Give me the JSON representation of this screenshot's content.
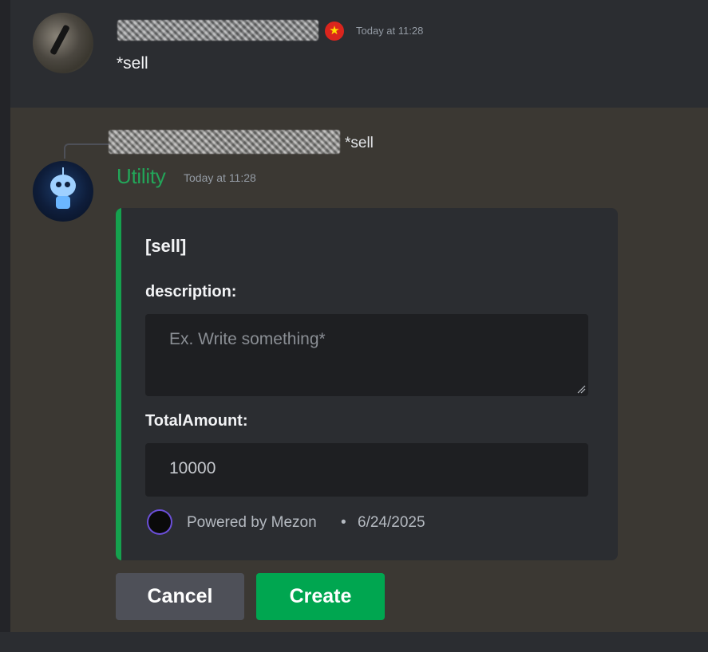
{
  "message1": {
    "author_blurred": true,
    "badge_icon": "vietnam-flag-star-icon",
    "timestamp": "Today at 11:28",
    "content": "*sell"
  },
  "message2": {
    "reply": {
      "author_blurred": true,
      "content": "*sell"
    },
    "author": "Utility",
    "author_color": "#23a559",
    "timestamp": "Today at 11:28",
    "embed": {
      "accent_color": "#15a14e",
      "title": "[sell]",
      "fields": {
        "description_label": "description:",
        "description_placeholder": "Ex. Write something*",
        "amount_label": "TotalAmount:",
        "amount_value": "10000"
      },
      "footer": {
        "text": "Powered by Mezon",
        "separator": "•",
        "date": "6/24/2025"
      }
    },
    "buttons": {
      "cancel": "Cancel",
      "create": "Create",
      "create_color": "#00a650"
    }
  }
}
